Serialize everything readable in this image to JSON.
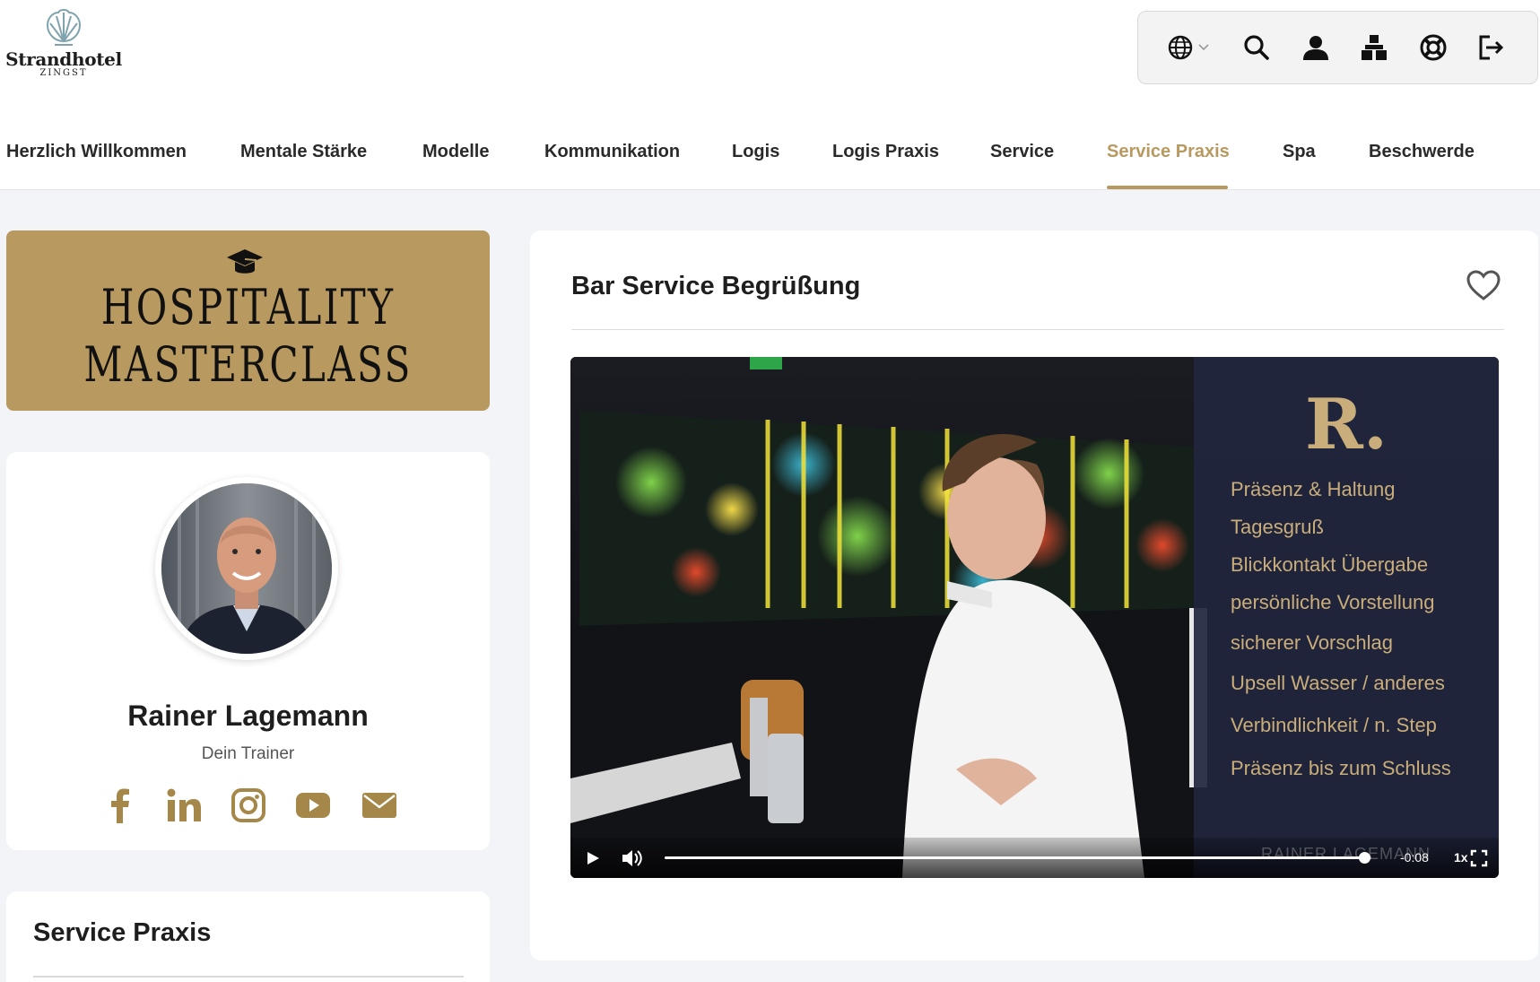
{
  "brand": {
    "name": "Strandhotel",
    "sub": "ZINGST",
    "accent": "#b8995f"
  },
  "toolbar": {
    "icons": [
      "globe-icon",
      "search-icon",
      "user-icon",
      "sitemap-icon",
      "lifebuoy-icon",
      "logout-icon"
    ]
  },
  "nav": {
    "items": [
      {
        "label": "Herzlich Willkommen"
      },
      {
        "label": "Mentale Stärke"
      },
      {
        "label": "Modelle"
      },
      {
        "label": "Kommunikation"
      },
      {
        "label": "Logis"
      },
      {
        "label": "Logis Praxis"
      },
      {
        "label": "Service"
      },
      {
        "label": "Service Praxis"
      },
      {
        "label": "Spa"
      },
      {
        "label": "Beschwerde"
      }
    ],
    "active": "Service Praxis"
  },
  "masterclass": {
    "line1": "HOSPITALITY",
    "line2": "MASTERCLASS"
  },
  "trainer": {
    "name": "Rainer Lagemann",
    "role": "Dein Trainer",
    "socials": [
      "facebook-icon",
      "linkedin-icon",
      "instagram-icon",
      "youtube-icon",
      "mail-icon"
    ]
  },
  "section": {
    "title": "Service Praxis"
  },
  "lesson": {
    "title": "Bar Service Begrüßung"
  },
  "video": {
    "logo": "R.",
    "steps": [
      "Präsenz & Haltung",
      "Tagesgruß",
      "Blickkontakt Übergabe",
      "persönliche Vorstellung",
      "sicherer Vorschlag",
      "Upsell Wasser / anderes",
      "Verbindlichkeit / n. Step",
      "Präsenz bis zum Schluss"
    ],
    "watermark": "RAINER LAGEMANN",
    "time": "-0:08",
    "speed": "1x",
    "progress": 0.99
  }
}
